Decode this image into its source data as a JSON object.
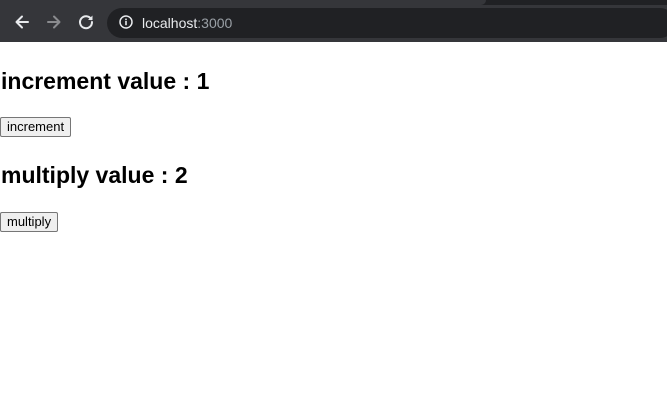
{
  "browser": {
    "url_host": "localhost",
    "url_port": ":3000",
    "icons": {
      "back": "arrow-left-icon",
      "forward": "arrow-right-icon",
      "reload": "reload-icon",
      "site_info": "info-icon"
    }
  },
  "page": {
    "increment": {
      "heading": "increment value : 1",
      "button_label": "increment"
    },
    "multiply": {
      "heading": "multiply value : 2",
      "button_label": "multiply"
    }
  }
}
